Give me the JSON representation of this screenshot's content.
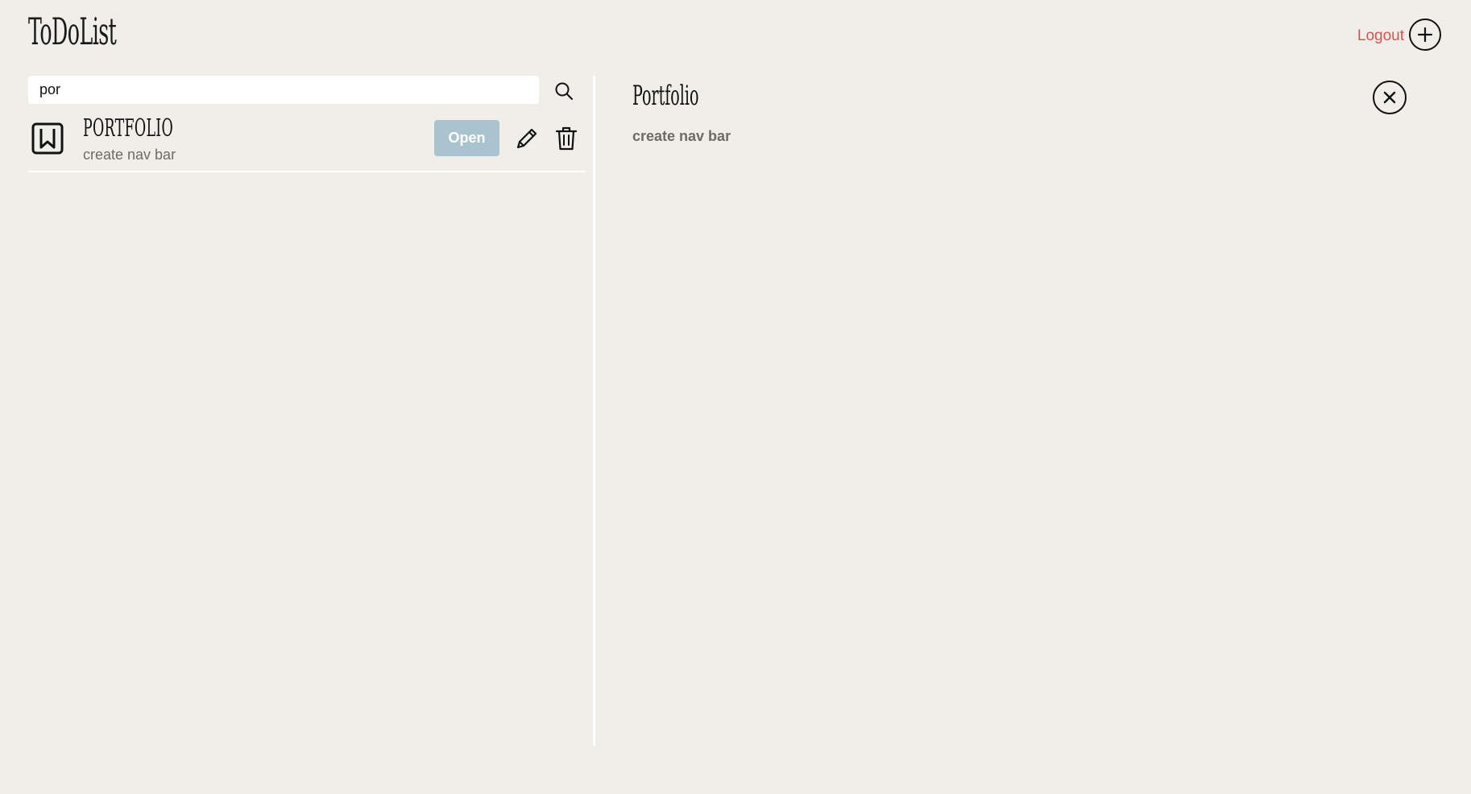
{
  "header": {
    "app_title": "ToDoList",
    "logout_label": "Logout",
    "add_icon": "plus-circle-icon"
  },
  "search": {
    "value": "por",
    "icon": "search-icon"
  },
  "list": {
    "items": [
      {
        "icon": "bookmark-icon",
        "title": "PORTFOLIO",
        "description": "create nav bar",
        "open_label": "Open",
        "edit_icon": "pencil-icon",
        "delete_icon": "trash-icon"
      }
    ]
  },
  "detail": {
    "title": "Portfolio",
    "description": "create nav bar",
    "close_icon": "close-icon"
  },
  "colors": {
    "background": "#f0eee8",
    "logout": "#d9534f",
    "open_button": "#a9c3cf",
    "muted_text": "#6f6a64"
  }
}
